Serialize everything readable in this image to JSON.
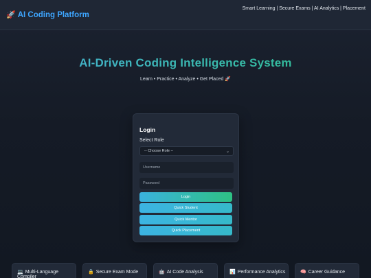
{
  "header": {
    "brand_icon": "🚀",
    "brand_title": "AI Coding Platform",
    "links": "Smart Learning | Secure Exams | AI Analytics | Placement"
  },
  "hero": {
    "title": "AI-Driven Coding Intelligence System",
    "subtitle": "Learn • Practice • Analyze • Get Placed 🚀"
  },
  "login": {
    "title": "Login",
    "role_label": "Select Role",
    "role_select_value": "-- Choose Role --",
    "username_placeholder": "Username",
    "password_placeholder": "Password",
    "login_button": "Login",
    "quick_student": "Quick Student",
    "quick_mentor": "Quick Mentor",
    "quick_placement": "Quick Placement"
  },
  "features": [
    {
      "icon": "💻",
      "label": "Multi-Language Compiler"
    },
    {
      "icon": "🔒",
      "label": "Secure Exam Mode"
    },
    {
      "icon": "🤖",
      "label": "AI Code Analysis"
    },
    {
      "icon": "📊",
      "label": "Performance Analytics"
    },
    {
      "icon": "🧠",
      "label": "Career Guidance"
    }
  ],
  "colors": {
    "accent_blue": "#3ea6ff",
    "gradient_start": "#3ab2de",
    "gradient_end": "#2ec184"
  }
}
